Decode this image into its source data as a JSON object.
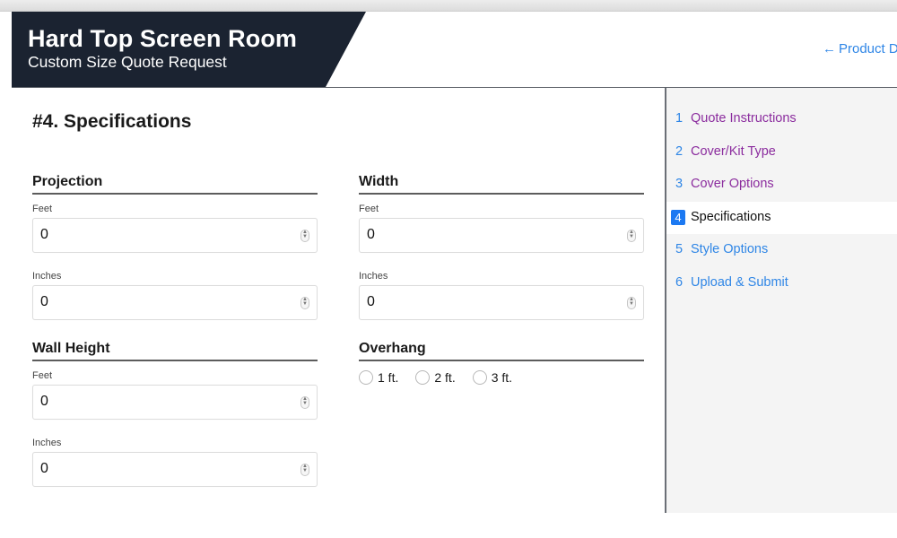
{
  "header": {
    "title": "Hard Top Screen Room",
    "subtitle": "Custom Size Quote Request",
    "back_link": {
      "icon": "arrow-left-icon",
      "arrow": "←",
      "label": "Product D"
    }
  },
  "section": {
    "title": "#4. Specifications"
  },
  "groups": {
    "projection": {
      "title": "Projection",
      "feet_label": "Feet",
      "feet_value": "0",
      "inches_label": "Inches",
      "inches_value": "0"
    },
    "width": {
      "title": "Width",
      "feet_label": "Feet",
      "feet_value": "0",
      "inches_label": "Inches",
      "inches_value": "0"
    },
    "wall_height": {
      "title": "Wall Height",
      "feet_label": "Feet",
      "feet_value": "0",
      "inches_label": "Inches",
      "inches_value": "0"
    },
    "overhang": {
      "title": "Overhang",
      "options": [
        {
          "label": "1 ft.",
          "checked": false
        },
        {
          "label": "2 ft.",
          "checked": false
        },
        {
          "label": "3 ft.",
          "checked": false
        }
      ]
    }
  },
  "spinner": {
    "up": "▲",
    "down": "▼"
  },
  "sidebar": {
    "items": [
      {
        "num": "1",
        "label": "Quote Instructions",
        "state": "visited"
      },
      {
        "num": "2",
        "label": "Cover/Kit Type",
        "state": "visited"
      },
      {
        "num": "3",
        "label": "Cover Options",
        "state": "visited"
      },
      {
        "num": "4",
        "label": "Specifications",
        "state": "active"
      },
      {
        "num": "5",
        "label": "Style Options",
        "state": "upcoming"
      },
      {
        "num": "6",
        "label": "Upload & Submit",
        "state": "upcoming"
      }
    ]
  },
  "colors": {
    "banner": "#1b2331",
    "link": "#2f86e6",
    "visited": "#8b2c9e",
    "active_badge": "#1c79f2"
  }
}
